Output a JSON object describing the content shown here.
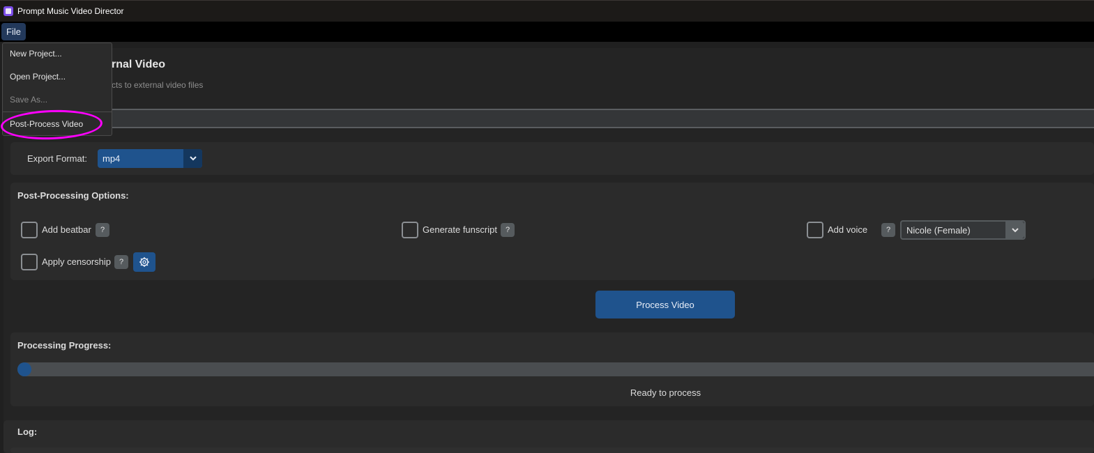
{
  "window": {
    "title": "Prompt Music Video Director"
  },
  "menubar": {
    "file_label": "File"
  },
  "file_menu": {
    "items": [
      {
        "label": "New Project...",
        "enabled": true
      },
      {
        "label": "Open Project...",
        "enabled": true
      },
      {
        "label": "Save As...",
        "enabled": false
      },
      {
        "label": "Post-Process Video",
        "enabled": true
      }
    ]
  },
  "header": {
    "title_partial": "rnal Video",
    "subtitle_partial": "cts to external video files"
  },
  "export": {
    "label": "Export Format:",
    "value": "mp4"
  },
  "options": {
    "title": "Post-Processing Options:",
    "add_beatbar": "Add beatbar",
    "generate_funscript": "Generate funscript",
    "add_voice": "Add voice",
    "voice_value": "Nicole (Female)",
    "apply_censorship": "Apply censorship",
    "help_label": "?"
  },
  "actions": {
    "process_label": "Process Video"
  },
  "progress": {
    "title": "Processing Progress:",
    "value": 0,
    "status": "Ready to process"
  },
  "log": {
    "title": "Log:"
  },
  "colors": {
    "accent": "#1f538d",
    "highlight_annotation": "#ff00ff"
  }
}
